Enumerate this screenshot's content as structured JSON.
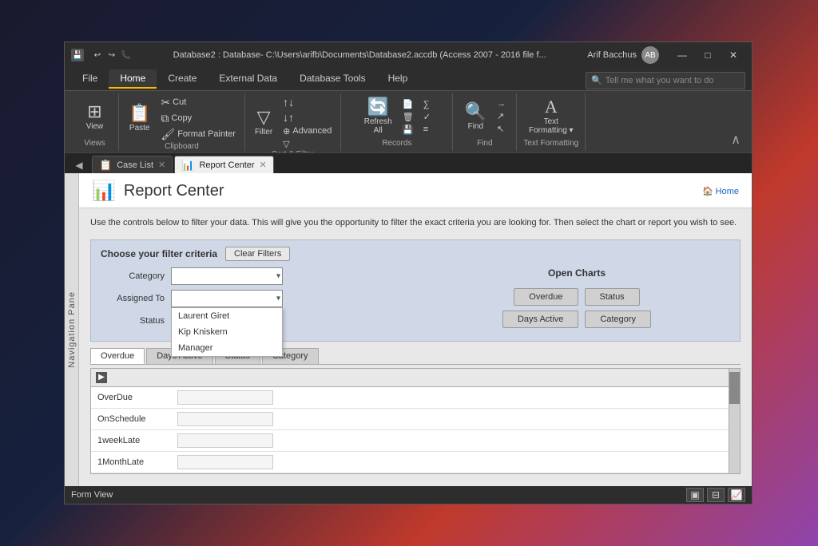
{
  "titleBar": {
    "icon": "💾",
    "controls": [
      "⟲",
      "⟳",
      "📞"
    ],
    "title": "Database2 : Database- C:\\Users\\arifb\\Documents\\Database2.accdb (Access 2007 - 2016 file f...",
    "user": "Arif Bacchus",
    "buttons": [
      "—",
      "□",
      "✕"
    ]
  },
  "ribbon": {
    "tabs": [
      "File",
      "Home",
      "Create",
      "External Data",
      "Database Tools",
      "Help"
    ],
    "activeTab": "Home",
    "searchPlaceholder": "Tell me what you want to do",
    "groups": [
      {
        "label": "Views",
        "items": [
          {
            "icon": "⊞",
            "label": "View",
            "big": true
          }
        ]
      },
      {
        "label": "Clipboard",
        "items": [
          {
            "icon": "📋",
            "label": "Paste",
            "big": true
          },
          {
            "icon": "✂",
            "label": "Cut"
          },
          {
            "icon": "⧉",
            "label": "Copy"
          },
          {
            "icon": "🖌",
            "label": "Format Painter"
          }
        ]
      },
      {
        "label": "Sort & Filter",
        "items": [
          {
            "icon": "▽",
            "label": "Filter"
          },
          {
            "icon": "↑↓",
            "label": "Ascending"
          },
          {
            "icon": "↓↑",
            "label": "Descending"
          },
          {
            "icon": "⊕",
            "label": "Advanced"
          },
          {
            "icon": "▽",
            "label": "Toggle Filter"
          }
        ]
      },
      {
        "label": "Records",
        "items": [
          {
            "icon": "🔄",
            "label": "Refresh All",
            "big": true
          },
          {
            "icon": "➕",
            "label": "New"
          },
          {
            "icon": "✗",
            "label": "Delete"
          },
          {
            "icon": "💾",
            "label": "Save"
          },
          {
            "icon": "∑",
            "label": "Totals"
          },
          {
            "icon": "✓",
            "label": "Spelling"
          },
          {
            "icon": "≡",
            "label": "More"
          }
        ]
      },
      {
        "label": "Find",
        "items": [
          {
            "icon": "🔍",
            "label": "Find",
            "big": true
          },
          {
            "icon": "→",
            "label": "Replace"
          },
          {
            "icon": "↗",
            "label": "Go To"
          },
          {
            "icon": "↖",
            "label": "Select"
          }
        ]
      },
      {
        "label": "Text Formatting",
        "items": [
          {
            "icon": "A",
            "label": "Text\nFormatting",
            "big": true
          }
        ]
      }
    ],
    "bottomLabels": [
      "Views",
      "Clipboard",
      "Sort & Filter",
      "Records",
      "Find"
    ]
  },
  "docTabs": [
    {
      "label": "Case List",
      "icon": "📋",
      "active": false
    },
    {
      "label": "Report Center",
      "icon": "📊",
      "active": true
    }
  ],
  "navPane": {
    "label": "Navigation Pane"
  },
  "reportCenter": {
    "title": "Report Center",
    "icon": "📊",
    "homeLink": "🏠 Home",
    "description": "Use the controls below to filter your data. This will give you the opportunity to filter the exact criteria\nyou are looking for. Then select the chart or report you wish to see.",
    "filter": {
      "title": "Choose your filter criteria",
      "clearButton": "Clear Filters",
      "fields": [
        {
          "label": "Category",
          "value": ""
        },
        {
          "label": "Assigned To",
          "value": ""
        },
        {
          "label": "Status",
          "value": ""
        }
      ],
      "dropdownItems": [
        "Laurent Giret",
        "Kip Kniskern",
        "Manager"
      ]
    },
    "openCharts": {
      "title": "Open Charts",
      "buttons": [
        [
          "Overdue",
          "Status"
        ],
        [
          "Days Active",
          "Category"
        ]
      ]
    },
    "dataTabs": [
      "Overdue",
      "Days Active",
      "Status",
      "Category"
    ],
    "activeDataTab": "Overdue",
    "dataRows": [
      {
        "label": "OverDue",
        "value": ""
      },
      {
        "label": "OnSchedule",
        "value": ""
      },
      {
        "label": "1weekLate",
        "value": ""
      },
      {
        "label": "1MonthLate",
        "value": ""
      }
    ]
  },
  "statusBar": {
    "text": "Form View",
    "icons": [
      "□□",
      "⊟",
      "📈"
    ]
  }
}
